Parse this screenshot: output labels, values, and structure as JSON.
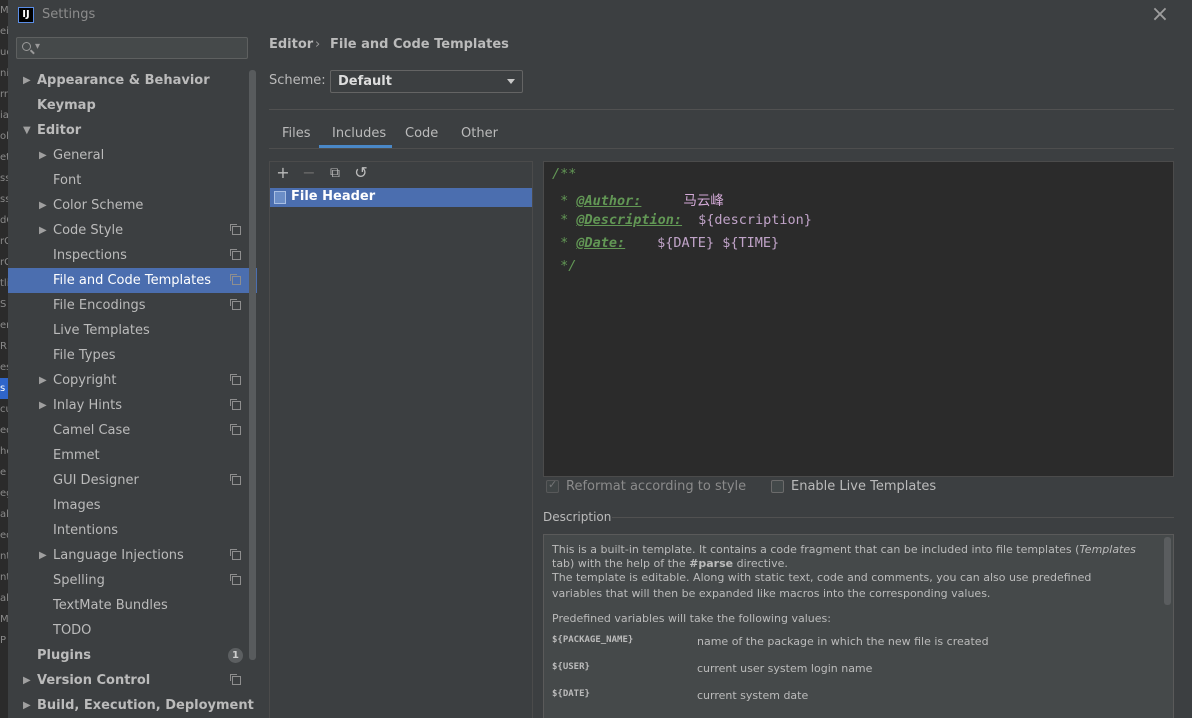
{
  "window": {
    "title": "Settings"
  },
  "search": {
    "placeholder": ""
  },
  "background_strip": [
    "Ma",
    "ei",
    "uc",
    "ni",
    "rm",
    "ia",
    "ol",
    "et",
    "ss",
    "ss",
    "dC",
    "rC",
    "rG",
    "tli",
    "S",
    "er",
    "R",
    "es",
    "s",
    "cu",
    "ed",
    "he",
    "e",
    "eg",
    "al",
    "eq",
    "nt",
    "nt",
    "al",
    "Ma",
    "P"
  ],
  "sidebar": {
    "items": [
      {
        "label": "Appearance & Behavior",
        "level": 0,
        "bold": true,
        "arrow": "right"
      },
      {
        "label": "Keymap",
        "level": 0,
        "bold": true
      },
      {
        "label": "Editor",
        "level": 0,
        "bold": true,
        "arrow": "down"
      },
      {
        "label": "General",
        "level": 1,
        "arrow": "right"
      },
      {
        "label": "Font",
        "level": 1
      },
      {
        "label": "Color Scheme",
        "level": 1,
        "arrow": "right"
      },
      {
        "label": "Code Style",
        "level": 1,
        "arrow": "right",
        "project_icon": true
      },
      {
        "label": "Inspections",
        "level": 1,
        "project_icon": true
      },
      {
        "label": "File and Code Templates",
        "level": 1,
        "project_icon": true,
        "selected": true
      },
      {
        "label": "File Encodings",
        "level": 1,
        "project_icon": true
      },
      {
        "label": "Live Templates",
        "level": 1
      },
      {
        "label": "File Types",
        "level": 1
      },
      {
        "label": "Copyright",
        "level": 1,
        "arrow": "right",
        "project_icon": true
      },
      {
        "label": "Inlay Hints",
        "level": 1,
        "arrow": "right",
        "project_icon": true
      },
      {
        "label": "Camel Case",
        "level": 1,
        "project_icon": true
      },
      {
        "label": "Emmet",
        "level": 1
      },
      {
        "label": "GUI Designer",
        "level": 1,
        "project_icon": true
      },
      {
        "label": "Images",
        "level": 1
      },
      {
        "label": "Intentions",
        "level": 1
      },
      {
        "label": "Language Injections",
        "level": 1,
        "arrow": "right",
        "project_icon": true
      },
      {
        "label": "Spelling",
        "level": 1,
        "project_icon": true
      },
      {
        "label": "TextMate Bundles",
        "level": 1
      },
      {
        "label": "TODO",
        "level": 1
      },
      {
        "label": "Plugins",
        "level": 0,
        "bold": true,
        "badge": "1"
      },
      {
        "label": "Version Control",
        "level": 0,
        "bold": true,
        "arrow": "right",
        "project_icon": true
      },
      {
        "label": "Build, Execution, Deployment",
        "level": 0,
        "bold": true,
        "arrow": "right"
      }
    ]
  },
  "breadcrumb": {
    "parent": "Editor",
    "separator": "›",
    "current": "File and Code Templates"
  },
  "scheme": {
    "label": "Scheme:",
    "value": "Default"
  },
  "tabs": [
    "Files",
    "Includes",
    "Code",
    "Other"
  ],
  "active_tab": "Includes",
  "toolbar": {
    "add": "+",
    "remove": "−",
    "copy": "⧉",
    "reset": "↺"
  },
  "templates": {
    "items": [
      "File Header"
    ],
    "selected": "File Header"
  },
  "editor": {
    "line1": "/**",
    "author_prefix": " * ",
    "author_tag": "@Author:",
    "author_value": "马云峰",
    "desc_prefix": " * ",
    "desc_tag": "@Description:",
    "desc_value": "${description}",
    "date_prefix": " * ",
    "date_tag": "@Date:",
    "date_value": "${DATE} ${TIME}",
    "line5": " */"
  },
  "options": {
    "reformat_label": "Reformat according to style",
    "reformat_checked": true,
    "reformat_disabled": true,
    "live_label": "Enable Live Templates",
    "live_checked": false
  },
  "description": {
    "heading": "Description",
    "p1a": "This is a built-in template. It contains a code fragment that can be included into file templates (",
    "p1_templates": "Templates",
    "p1b": "tab) with the help of the ",
    "p1_parse": "#parse",
    "p1c": " directive.",
    "p2a": "The template is editable. Along with static text, code and comments, you can also use predefined",
    "p2b": "variables that will then be expanded like macros into the corresponding values.",
    "p3": "Predefined variables will take the following values:",
    "vars": [
      {
        "name": "${PACKAGE_NAME}",
        "desc": "name of the package in which the new file is created"
      },
      {
        "name": "${USER}",
        "desc": "current user system login name"
      },
      {
        "name": "${DATE}",
        "desc": "current system date"
      }
    ]
  },
  "colors": {
    "selection": "#4b6eaf",
    "background": "#3c3f41",
    "editor_bg": "#2b2b2b",
    "comment": "#629755",
    "accent": "#4a88c7"
  }
}
